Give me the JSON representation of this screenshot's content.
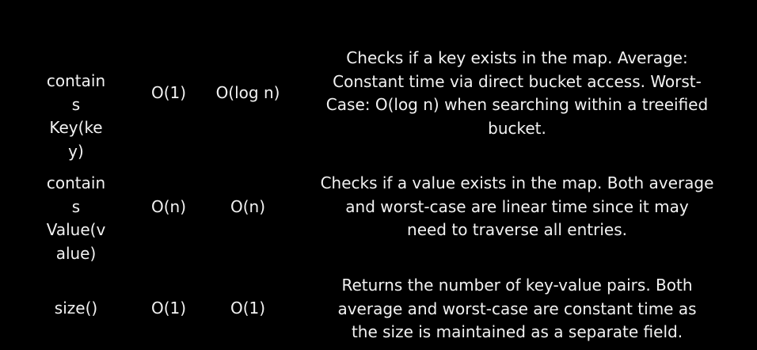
{
  "rows": [
    {
      "method_lines": [
        "contains",
        "Key(key)"
      ],
      "average": "O(1)",
      "worst": "O(log n)",
      "description_lines": [
        "Checks if a key exists in the map. Average:",
        "Constant time via direct bucket access. Worst-",
        "Case: O(log n) when searching within a treeified",
        "bucket."
      ]
    },
    {
      "method_lines": [
        "contains",
        "Value(v",
        "alue)"
      ],
      "average": "O(n)",
      "worst": "O(n)",
      "description_lines": [
        "Checks if a value exists in the map. Both average",
        "and worst-case are linear time since it may",
        "need to traverse all entries."
      ]
    },
    {
      "method_lines": [
        "size()"
      ],
      "average": "O(1)",
      "worst": "O(1)",
      "description_lines": [
        "Returns the number of key-value pairs. Both",
        "average and worst-case are constant time as",
        "the size is maintained as a separate field."
      ]
    }
  ]
}
